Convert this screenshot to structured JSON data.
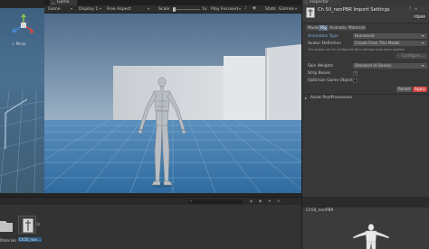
{
  "game_tab": {
    "label": "Game"
  },
  "game_toolbar": {
    "display_mode": "Game",
    "display": "Display 1",
    "aspect": "Free Aspect",
    "scale_label": "Scale",
    "scale_value": "1x",
    "play_mode": "Play Focused",
    "stats_label": "Stats",
    "gizmos_label": "Gizmos"
  },
  "scene_gizmo": {
    "persp_label": "< Persp"
  },
  "inspector": {
    "tab_label": "Inspector",
    "title": "Ch 50_nonPBR Import Settings",
    "open_button": "Open",
    "tabs": [
      "Model",
      "Rig",
      "Animation",
      "Materials"
    ],
    "active_tab_index": 1,
    "animation_type_label": "Animation Type",
    "animation_type_value": "Humanoid",
    "avatar_definition_label": "Avatar Definition",
    "avatar_definition_value": "Create From This Model",
    "avatar_help_text": "The avatar can be configured after settings have been applied.",
    "configure_button": "Configure...",
    "skin_weights_label": "Skin Weights",
    "skin_weights_value": "Standard (4 Bones)",
    "strip_bones_label": "Strip Bones",
    "optimize_label": "Optimize Game Objects",
    "revert_button": "Revert",
    "apply_button": "Apply",
    "postprocessors_label": "Asset PostProcessors",
    "preview_label": "Ch50_nonPBR",
    "accent_color": "#2c5d87",
    "apply_color": "#d24343"
  },
  "project": {
    "folder_label": "Materials",
    "asset_label": "Ch50_non..."
  }
}
